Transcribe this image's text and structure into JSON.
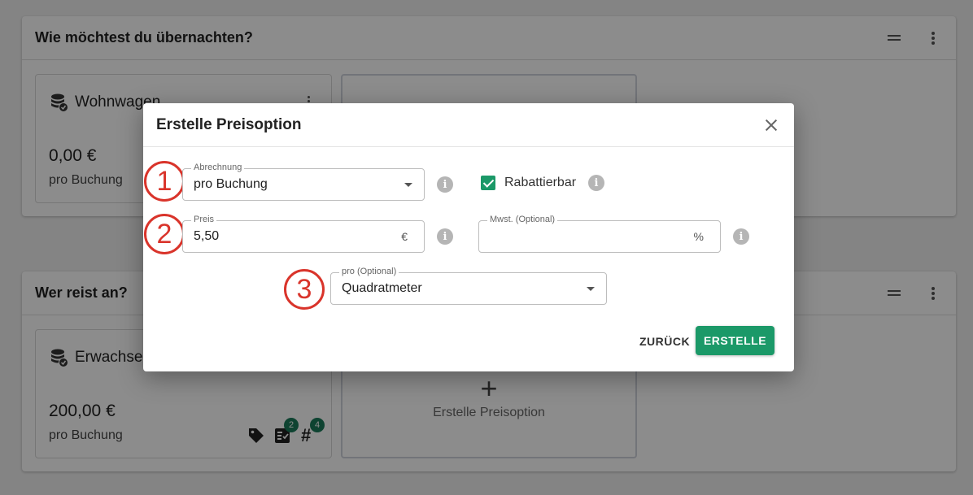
{
  "sections": [
    {
      "title": "Wie möchtest du übernachten?"
    },
    {
      "title": "Wer reist an?"
    }
  ],
  "cards": {
    "wohnwagen": {
      "title": "Wohnwagen",
      "price": "0,00 €",
      "unit": "pro Buchung"
    },
    "erwachsene": {
      "title": "Erwachse",
      "price": "200,00 €",
      "unit": "pro Buchung",
      "badge_1": "2",
      "badge_2": "4",
      "hash_glyph": "#"
    }
  },
  "add_card": {
    "plus": "+",
    "label": "Erstelle Preisoption"
  },
  "dialog": {
    "title": "Erstelle Preisoption",
    "abrechnung": {
      "label": "Abrechnung",
      "value": "pro Buchung"
    },
    "rabattierbar": {
      "label": "Rabattierbar",
      "checked": true
    },
    "preis": {
      "label": "Preis",
      "value": "5,50",
      "suffix": "€"
    },
    "mwst": {
      "label": "Mwst. (Optional)",
      "value": "",
      "suffix": "%"
    },
    "pro": {
      "label": "pro (Optional)",
      "value": "Quadratmeter"
    },
    "back_label": "ZURÜCK",
    "create_label": "ERSTELLE"
  },
  "annotations": [
    "1",
    "2",
    "3"
  ],
  "colors": {
    "primary": "#1b9968",
    "annotation": "#d9342b",
    "badge": "#1b7a5a"
  }
}
